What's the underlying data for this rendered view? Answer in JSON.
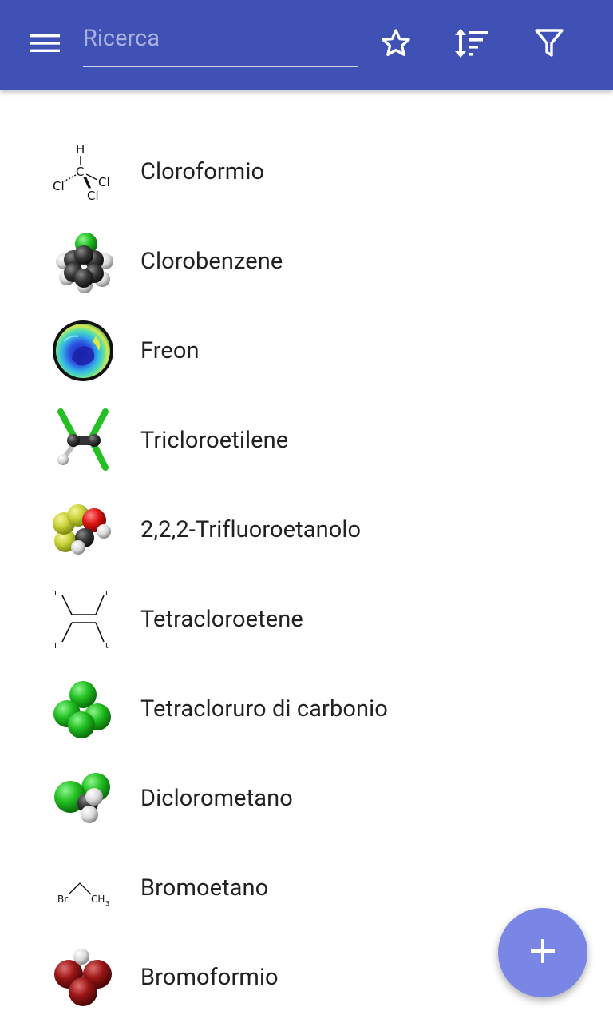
{
  "toolbar": {
    "search": {
      "placeholder": "Ricerca",
      "value": ""
    },
    "color": "#3f51b5",
    "icons": [
      "menu-icon",
      "star-outline-icon",
      "sort-icon",
      "filter-icon"
    ]
  },
  "compounds": [
    {
      "name": "Cloroformio",
      "icon": "chloroform-structure-icon"
    },
    {
      "name": "Clorobenzene",
      "icon": "chlorobenzene-model-icon"
    },
    {
      "name": "Freon",
      "icon": "ozone-hole-map-icon"
    },
    {
      "name": "Tricloroetilene",
      "icon": "trichloroethylene-model-icon"
    },
    {
      "name": "2,2,2-Trifluoroetanolo",
      "icon": "trifluoroethanol-model-icon"
    },
    {
      "name": "Tetracloroetene",
      "icon": "tetrachloroethene-structure-icon"
    },
    {
      "name": "Tetracloruro di carbonio",
      "icon": "carbon-tetrachloride-model-icon"
    },
    {
      "name": "Diclorometano",
      "icon": "dichloromethane-model-icon"
    },
    {
      "name": "Bromoetano",
      "icon": "bromoethane-structure-icon"
    },
    {
      "name": "Bromoformio",
      "icon": "bromoform-model-icon"
    }
  ],
  "fab": {
    "icon": "add-icon",
    "color": "#7986e6"
  }
}
